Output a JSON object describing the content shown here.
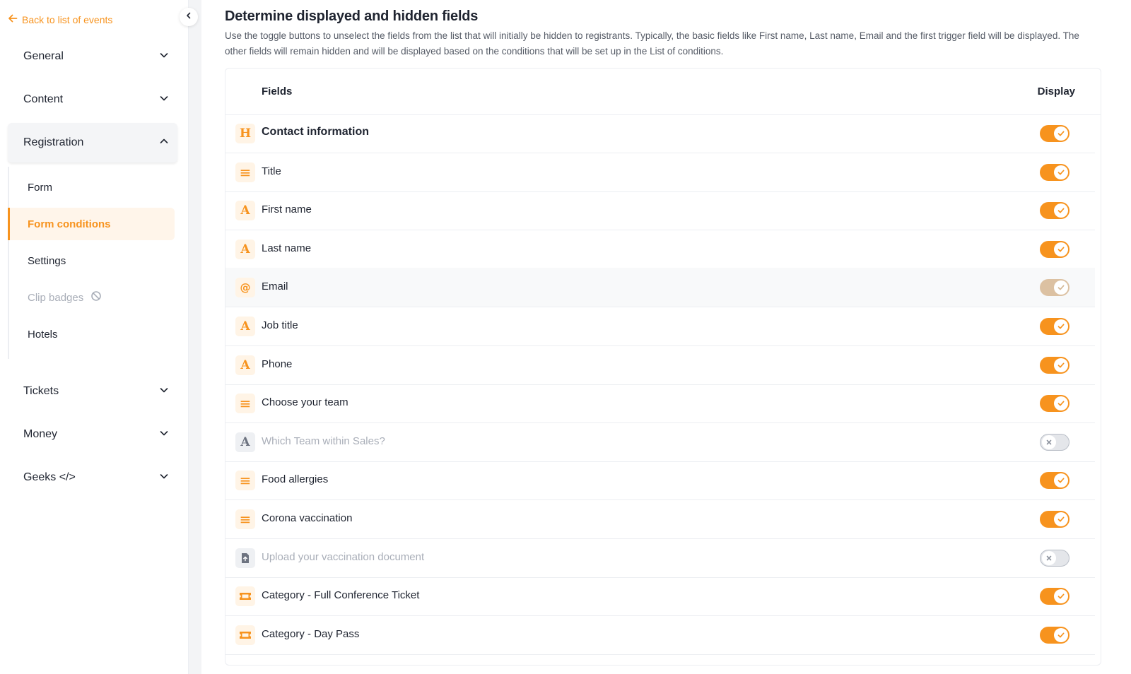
{
  "colors": {
    "accent": "#f7931e",
    "accent_soft": "#fff4e6",
    "muted_text": "#a9aeb8"
  },
  "sidebar": {
    "back_label": "Back to list of events",
    "groups": [
      {
        "label": "General",
        "icon": "chevron-down-icon"
      },
      {
        "label": "Content",
        "icon": "chevron-down-icon"
      },
      {
        "label": "Registration",
        "icon": "chevron-up-icon",
        "expanded": true
      },
      {
        "label": "Tickets",
        "icon": "chevron-down-icon"
      },
      {
        "label": "Money",
        "icon": "chevron-down-icon"
      },
      {
        "label": "Geeks </>",
        "icon": "chevron-down-icon"
      }
    ],
    "registration_items": [
      {
        "label": "Form"
      },
      {
        "label": "Form conditions",
        "active": true
      },
      {
        "label": "Settings"
      },
      {
        "label": "Clip badges",
        "disabled": true,
        "icon": "ban-icon"
      },
      {
        "label": "Hotels"
      }
    ]
  },
  "main": {
    "title": "Determine displayed and hidden fields",
    "description": "Use the toggle buttons to unselect the fields from the list that will initially be hidden to registrants. Typically, the basic fields like First name, Last name, Email and the first trigger field will be displayed. The other fields will remain hidden and will be displayed based on the conditions that will be set up in the List of conditions.",
    "columns": {
      "fields": "Fields",
      "display": "Display"
    },
    "rows": [
      {
        "icon": "heading-icon",
        "glyph": "H",
        "label": "Contact information",
        "display": true
      },
      {
        "icon": "list-icon",
        "glyph": "≡",
        "label": "Title",
        "display": true
      },
      {
        "icon": "text-field-icon",
        "glyph": "A",
        "label": "First name",
        "display": true
      },
      {
        "icon": "text-field-icon",
        "glyph": "A",
        "label": "Last name",
        "display": true
      },
      {
        "icon": "at-sign-icon",
        "glyph": "@",
        "label": "Email",
        "display": true,
        "locked": true
      },
      {
        "icon": "text-field-icon",
        "glyph": "A",
        "label": "Job title",
        "display": true
      },
      {
        "icon": "text-field-icon",
        "glyph": "A",
        "label": "Phone",
        "display": true
      },
      {
        "icon": "list-icon",
        "glyph": "≡",
        "label": "Choose your team",
        "display": true
      },
      {
        "icon": "text-field-icon",
        "glyph": "A",
        "label": "Which Team within Sales?",
        "display": false
      },
      {
        "icon": "list-icon",
        "glyph": "≡",
        "label": "Food allergies",
        "display": true
      },
      {
        "icon": "list-icon",
        "glyph": "≡",
        "label": "Corona vaccination",
        "display": true
      },
      {
        "icon": "file-upload-icon",
        "glyph": "file",
        "label": "Upload your vaccination document",
        "display": false
      },
      {
        "icon": "ticket-icon",
        "glyph": "ticket",
        "label": "Category - Full Conference Ticket",
        "display": true
      },
      {
        "icon": "ticket-icon",
        "glyph": "ticket",
        "label": "Category - Day Pass",
        "display": true
      }
    ]
  }
}
